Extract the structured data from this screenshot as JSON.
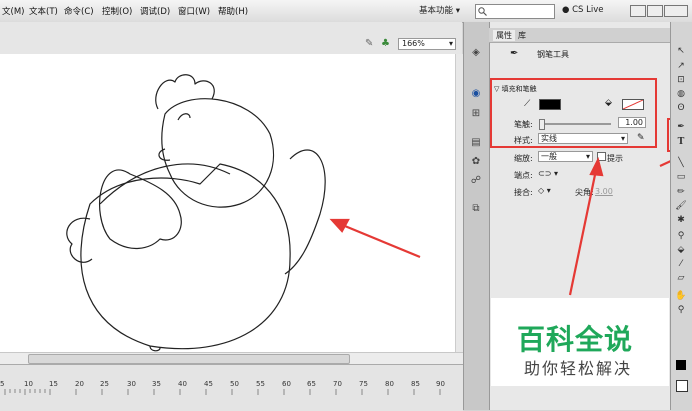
{
  "menubar": {
    "items": [
      "文(M)",
      "文本(T)",
      "命令(C)",
      "控制(O)",
      "调试(D)",
      "窗口(W)",
      "帮助(H)"
    ],
    "workspace": "基本功能 ▾",
    "search_placeholder": "",
    "cs_live": "CS Live"
  },
  "stage": {
    "zoom": "166%"
  },
  "timeline": {
    "ruler_labels": [
      "5",
      "10",
      "15",
      "20",
      "25",
      "30",
      "35",
      "40",
      "45",
      "50",
      "55",
      "60",
      "65",
      "70",
      "75",
      "80",
      "85",
      "90"
    ]
  },
  "panel": {
    "tabs": [
      "属性",
      "库"
    ],
    "tool_name": "钢笔工具",
    "section_fill_stroke": "▽ 填充和笔触",
    "stroke_label": "笔触:",
    "stroke_value": "1.00",
    "style_label": "样式:",
    "style_value": "实线",
    "scale_label": "缩放:",
    "scale_value": "一般",
    "hint_label": "提示",
    "cap_label": "端点:",
    "join_label": "接合:",
    "miter_label": "尖角:",
    "miter_value": "3.00"
  },
  "watermark": {
    "title": "百科全说",
    "subtitle": "助你轻松解决"
  },
  "colors": {
    "annotation_red": "#e53935",
    "watermark_green": "#1fa85a"
  }
}
